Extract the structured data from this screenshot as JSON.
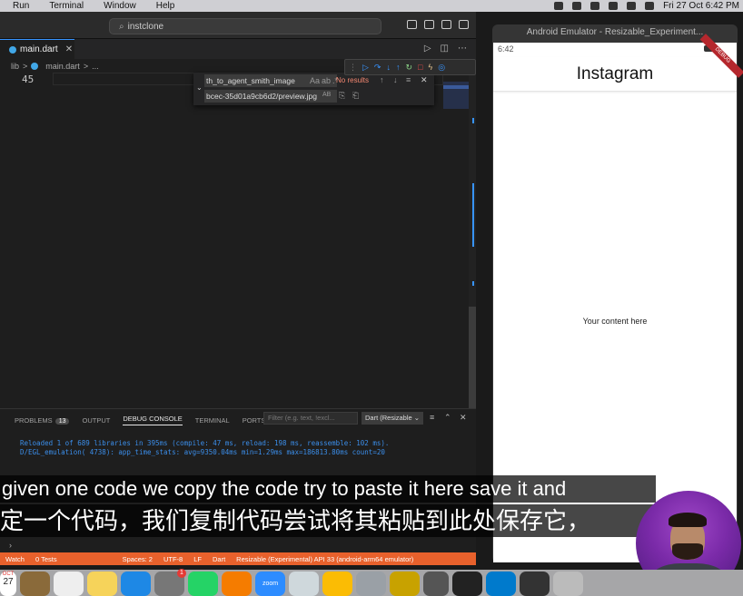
{
  "menubar": {
    "items": [
      "Run",
      "Terminal",
      "Window",
      "Help"
    ],
    "datetime": "Fri 27 Oct  6:42 PM"
  },
  "vscode": {
    "search_text": "instclone",
    "tab_title": "main.dart",
    "breadcrumb": [
      "lib",
      ">",
      "main.dart",
      ">",
      "..."
    ],
    "line_number": "45",
    "find_widget": {
      "find_value": "th_to_agent_smith_image",
      "replace_value": "bcec-35d01a9cb6d2/preview.jpg",
      "no_results": "No results",
      "opt_case": "Aa",
      "opt_word": "ab",
      "opt_regex": ".*",
      "opt_preserve": "AB"
    },
    "panel": {
      "tabs": [
        "PROBLEMS",
        "OUTPUT",
        "DEBUG CONSOLE",
        "TERMINAL",
        "PORTS"
      ],
      "problems_count": "13",
      "filter_placeholder": "Filter (e.g. text, !excl...",
      "session": "Dart (Resizable",
      "console_lines": [
        "Reloaded 1 of 689 libraries in 395ms (compile: 47 ms, reload: 198 ms, reassemble: 102 ms).",
        "D/EGL_emulation( 4738): app_time_stats: avg=9350.04ms min=1.29ms max=186813.80ms count=20"
      ]
    },
    "statusbar": {
      "watch": "Watch",
      "tests": "0 Tests",
      "spaces": "Spaces: 2",
      "encoding": "UTF-8",
      "eol": "LF",
      "language": "Dart",
      "device": "Resizable (Experimental) API 33 (android-arm64 emulator)"
    }
  },
  "emulator": {
    "window_title": "Android Emulator - Resizable_Experiment...",
    "time": "6:42",
    "debug_banner": "DEBUG",
    "app_title": "Instagram",
    "content": "Your content here"
  },
  "subtitles": {
    "english": "given one code we copy the code try to paste it here save it and",
    "chinese": "定一个代码，我们复制代码尝试将其粘贴到此处保存它，"
  },
  "dock": {
    "calendar_month": "OCT",
    "calendar_day": "27",
    "zoom_label": "zoom"
  }
}
